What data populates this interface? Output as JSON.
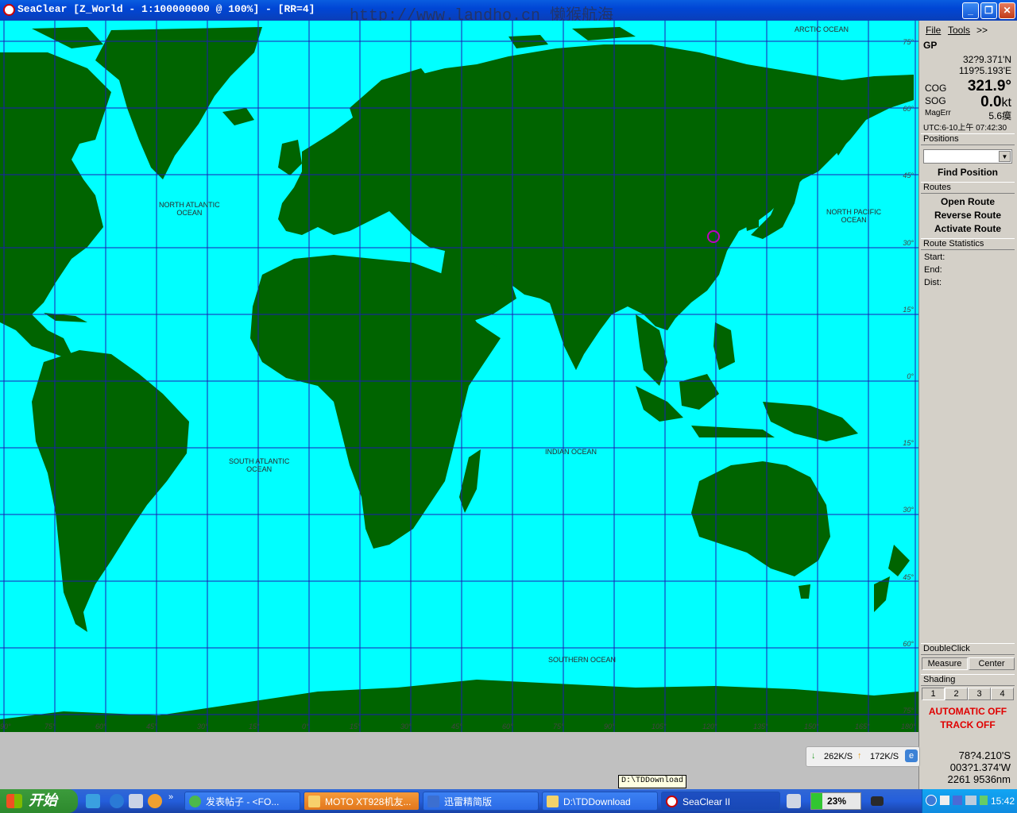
{
  "window": {
    "title": "SeaClear [Z_World - 1:100000000 @ 100%] - [RR=4]",
    "watermark": "http://www.landho.cn 懒猴航海"
  },
  "map": {
    "ocean_labels": [
      {
        "text": "ARCTIC OCEAN"
      },
      {
        "text": "NORTH ATLANTIC\nOCEAN"
      },
      {
        "text": "NORTH PACIFIC\nOCEAN"
      },
      {
        "text": "SOUTH ATLANTIC\nOCEAN"
      },
      {
        "text": "INDIAN OCEAN"
      },
      {
        "text": "SOUTHERN OCEAN"
      }
    ],
    "lat_labels": [
      "75°",
      "60°",
      "45°",
      "30°",
      "15°",
      "0°",
      "15°",
      "30°",
      "45°",
      "60°",
      "75°"
    ],
    "lon_labels": [
      "90°",
      "75°",
      "60°",
      "45°",
      "30°",
      "15°",
      "0°",
      "15°",
      "30°",
      "45°",
      "60°",
      "75°",
      "90°",
      "105°",
      "120°",
      "135°",
      "150°",
      "165°",
      "180°"
    ],
    "colors": {
      "water": "#00ffff",
      "land": "#006400",
      "grid": "#1c1cb4",
      "marker": "#c000c0"
    }
  },
  "panel": {
    "menu": {
      "file": "File",
      "tools": "Tools",
      "more": ">>"
    },
    "gp": {
      "header": "GP",
      "lat": "32?9.371'N",
      "lon": "119?5.193'E",
      "cog_label": "COG",
      "cog_value": "321.9°",
      "sog_label": "SOG",
      "sog_value": "0.0",
      "sog_unit": "kt",
      "magerr_label": "MagErr",
      "magerr_value": "5.6瘼",
      "utc": "UTC:6-10上午 07:42:30"
    },
    "positions": {
      "header": "Positions",
      "find": "Find Position"
    },
    "routes": {
      "header": "Routes",
      "open": "Open Route",
      "reverse": "Reverse Route",
      "activate": "Activate Route"
    },
    "route_stats": {
      "header": "Route Statistics",
      "start": "Start:",
      "end": "End:",
      "dist": "Dist:"
    },
    "doubleclick": {
      "header": "DoubleClick",
      "measure": "Measure",
      "center": "Center"
    },
    "shading": {
      "header": "Shading",
      "options": [
        "1",
        "2",
        "3",
        "4"
      ]
    },
    "status": {
      "automatic": "AUTOMATIC OFF",
      "track": "TRACK OFF"
    },
    "cursor": {
      "lat": "78?4.210'S",
      "lon": "003?1.374'W",
      "dist": "2261 9536nm"
    }
  },
  "speed_widget": {
    "down": "262K/S",
    "up": "172K/S"
  },
  "tooltip": "D:\\TDDownload",
  "taskbar": {
    "start": "开始",
    "tasks": [
      {
        "label": "发表帖子 - <FO..."
      },
      {
        "label": "MOTO XT928机友..."
      },
      {
        "label": "迅雷精简版"
      },
      {
        "label": "D:\\TDDownload"
      },
      {
        "label": "SeaClear II"
      }
    ],
    "battery": "23%",
    "clock": "15:42"
  }
}
